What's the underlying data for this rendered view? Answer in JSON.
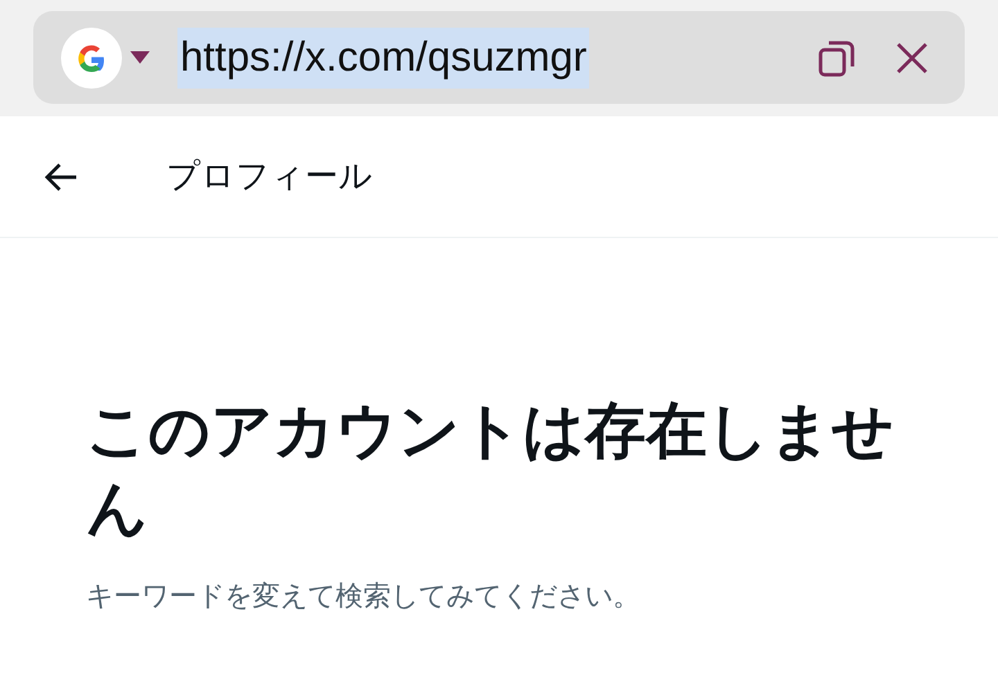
{
  "address_bar": {
    "url": "https://x.com/qsuzmgr",
    "url_selected": true
  },
  "header": {
    "title": "プロフィール"
  },
  "message": {
    "title": "このアカウントは存在しません",
    "body": "キーワードを変えて検索してみてください。"
  }
}
